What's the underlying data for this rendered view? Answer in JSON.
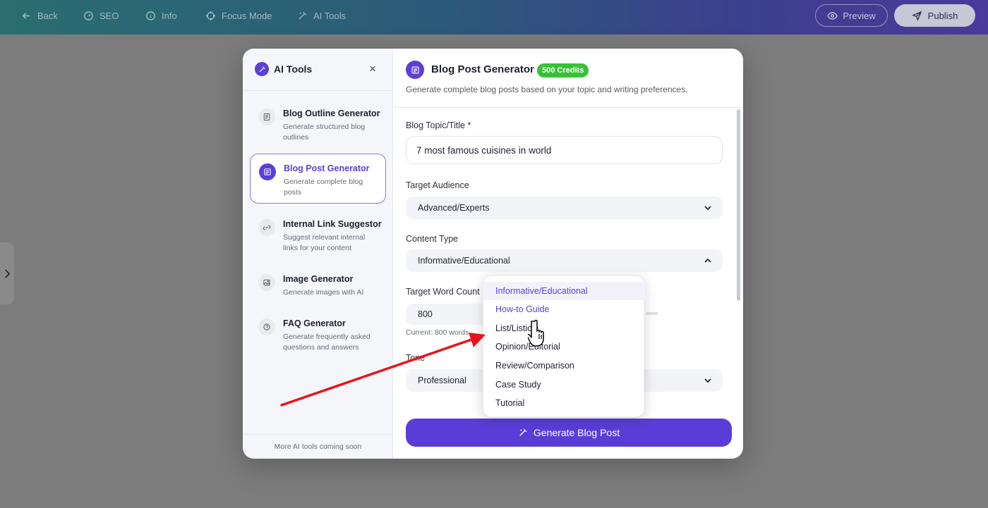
{
  "topbar": {
    "back": "Back",
    "seo": "SEO",
    "info": "Info",
    "focus_mode": "Focus Mode",
    "ai_tools": "AI Tools",
    "preview": "Preview",
    "publish": "Publish"
  },
  "sidebar": {
    "title": "AI Tools",
    "close": "×",
    "tools": [
      {
        "name": "Blog Outline Generator",
        "desc": "Generate structured blog outlines",
        "icon": "document-icon"
      },
      {
        "name": "Blog Post Generator",
        "desc": "Generate complete blog posts",
        "icon": "article-icon"
      },
      {
        "name": "Internal Link Suggestor",
        "desc": "Suggest relevant internal links for your content",
        "icon": "link-icon"
      },
      {
        "name": "Image Generator",
        "desc": "Generate images with AI",
        "icon": "image-icon"
      },
      {
        "name": "FAQ Generator",
        "desc": "Generate frequently asked questions and answers",
        "icon": "question-icon"
      }
    ],
    "footer": "More AI tools coming soon"
  },
  "main": {
    "title": "Blog Post Generator",
    "credits": "500 Credits",
    "subtitle": "Generate complete blog posts based on your topic and writing preferences.",
    "topic_label": "Blog Topic/Title *",
    "topic_value": "7 most famous cuisines in world",
    "audience_label": "Target Audience",
    "audience_value": "Advanced/Experts",
    "content_type_label": "Content Type",
    "content_type_value": "Informative/Educational",
    "word_count_label": "Target Word Count",
    "word_count_value": "800",
    "word_count_hint": "Current: 800 words",
    "tone_label": "Tone",
    "tone_value": "Professional",
    "generate_button": "Generate Blog Post"
  },
  "dropdown": {
    "options": [
      "Informative/Educational",
      "How-to Guide",
      "List/Listicle",
      "Opinion/Editorial",
      "Review/Comparison",
      "Case Study",
      "Tutorial"
    ],
    "selected": "Informative/Educational",
    "hovered": "How-to Guide"
  },
  "colors": {
    "accent": "#5b3fd6",
    "badge_green": "#38c038",
    "annotation_arrow": "#e8141b"
  }
}
